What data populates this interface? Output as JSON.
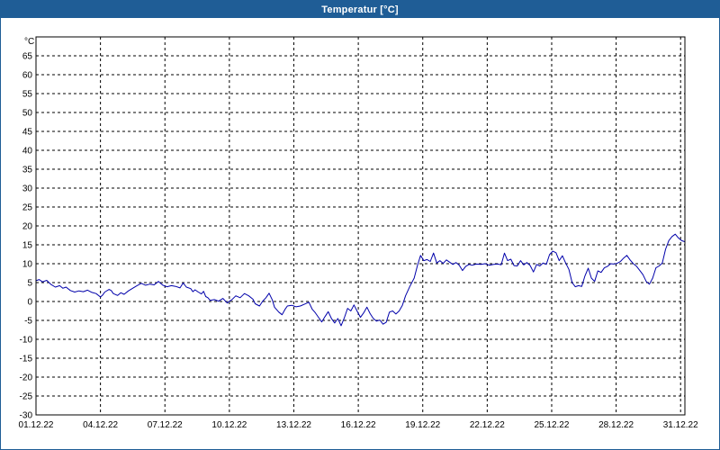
{
  "window": {
    "title": "Temperatur [°C]"
  },
  "chart_data": {
    "type": "line",
    "title": "Temperatur [°C]",
    "ylabel": "°C",
    "xlabel": "",
    "ylim": [
      -30,
      70
    ],
    "grid": true,
    "x_range": [
      "01.12.22",
      "02.01.23"
    ],
    "x_ticks": [
      "01.12.22",
      "04.12.22",
      "07.12.22",
      "10.12.22",
      "13.12.22",
      "16.12.22",
      "19.12.22",
      "22.12.22",
      "25.12.22",
      "28.12.22",
      "31.12.22"
    ],
    "y_ticks": [
      65,
      60,
      55,
      50,
      45,
      40,
      35,
      30,
      25,
      20,
      15,
      10,
      5,
      0,
      -5,
      -10,
      -15,
      -20,
      -25,
      -30
    ],
    "line_color": "#0000aa",
    "series": [
      {
        "values": [
          [
            0,
            5.5
          ],
          [
            0.15,
            5.8
          ],
          [
            0.3,
            5.2
          ],
          [
            0.5,
            5.6
          ],
          [
            0.7,
            4.5
          ],
          [
            0.9,
            3.8
          ],
          [
            1.1,
            4.2
          ],
          [
            1.25,
            3.5
          ],
          [
            1.4,
            3.8
          ],
          [
            1.6,
            2.9
          ],
          [
            1.8,
            2.5
          ],
          [
            2.0,
            2.8
          ],
          [
            2.2,
            2.6
          ],
          [
            2.4,
            3.0
          ],
          [
            2.6,
            2.4
          ],
          [
            2.8,
            2.1
          ],
          [
            3.0,
            1.2
          ],
          [
            3.1,
            1.7
          ],
          [
            3.2,
            2.5
          ],
          [
            3.4,
            3.2
          ],
          [
            3.5,
            2.9
          ],
          [
            3.6,
            2.1
          ],
          [
            3.8,
            1.6
          ],
          [
            3.95,
            2.3
          ],
          [
            4.1,
            1.9
          ],
          [
            4.3,
            2.8
          ],
          [
            4.5,
            3.5
          ],
          [
            4.7,
            4.2
          ],
          [
            4.9,
            4.8
          ],
          [
            5.1,
            4.3
          ],
          [
            5.3,
            4.6
          ],
          [
            5.5,
            4.4
          ],
          [
            5.7,
            5.3
          ],
          [
            5.9,
            4.3
          ],
          [
            6.1,
            3.9
          ],
          [
            6.3,
            4.2
          ],
          [
            6.5,
            4.0
          ],
          [
            6.7,
            3.6
          ],
          [
            6.85,
            4.9
          ],
          [
            7.0,
            3.8
          ],
          [
            7.2,
            3.4
          ],
          [
            7.3,
            2.6
          ],
          [
            7.4,
            3.1
          ],
          [
            7.55,
            2.5
          ],
          [
            7.7,
            2.0
          ],
          [
            7.8,
            2.7
          ],
          [
            7.9,
            1.3
          ],
          [
            8.0,
            1.0
          ],
          [
            8.1,
            0.3
          ],
          [
            8.3,
            0.5
          ],
          [
            8.5,
            0.1
          ],
          [
            8.7,
            0.8
          ],
          [
            8.9,
            -0.4
          ],
          [
            9.0,
            0.1
          ],
          [
            9.1,
            0.4
          ],
          [
            9.3,
            1.5
          ],
          [
            9.5,
            1.0
          ],
          [
            9.7,
            2.1
          ],
          [
            9.9,
            1.5
          ],
          [
            10.1,
            0.6
          ],
          [
            10.2,
            -0.6
          ],
          [
            10.4,
            -1.2
          ],
          [
            10.55,
            0.1
          ],
          [
            10.7,
            1.0
          ],
          [
            10.85,
            2.2
          ],
          [
            11.0,
            0.4
          ],
          [
            11.1,
            -1.5
          ],
          [
            11.3,
            -2.8
          ],
          [
            11.45,
            -3.5
          ],
          [
            11.6,
            -2.0
          ],
          [
            11.7,
            -1.2
          ],
          [
            11.9,
            -1.0
          ],
          [
            12.1,
            -1.4
          ],
          [
            12.3,
            -1.2
          ],
          [
            12.5,
            -0.7
          ],
          [
            12.7,
            -0.2
          ],
          [
            12.85,
            -2.0
          ],
          [
            13.0,
            -3.0
          ],
          [
            13.15,
            -4.2
          ],
          [
            13.3,
            -5.4
          ],
          [
            13.45,
            -4.0
          ],
          [
            13.6,
            -2.7
          ],
          [
            13.75,
            -4.5
          ],
          [
            13.9,
            -5.7
          ],
          [
            14.05,
            -4.5
          ],
          [
            14.2,
            -6.4
          ],
          [
            14.35,
            -4.3
          ],
          [
            14.5,
            -1.8
          ],
          [
            14.65,
            -2.5
          ],
          [
            14.8,
            -0.9
          ],
          [
            14.95,
            -2.6
          ],
          [
            15.1,
            -4.2
          ],
          [
            15.25,
            -3.0
          ],
          [
            15.4,
            -1.5
          ],
          [
            15.55,
            -3.2
          ],
          [
            15.7,
            -4.5
          ],
          [
            15.85,
            -5.2
          ],
          [
            16.0,
            -4.9
          ],
          [
            16.15,
            -6.0
          ],
          [
            16.3,
            -5.5
          ],
          [
            16.45,
            -2.8
          ],
          [
            16.6,
            -2.5
          ],
          [
            16.75,
            -3.3
          ],
          [
            16.9,
            -2.5
          ],
          [
            17.05,
            -1.0
          ],
          [
            17.2,
            1.5
          ],
          [
            17.4,
            4.0
          ],
          [
            17.6,
            6.2
          ],
          [
            17.75,
            9.5
          ],
          [
            17.9,
            12.2
          ],
          [
            18.05,
            10.8
          ],
          [
            18.2,
            11.1
          ],
          [
            18.35,
            10.6
          ],
          [
            18.5,
            12.8
          ],
          [
            18.65,
            10.2
          ],
          [
            18.8,
            10.8
          ],
          [
            18.95,
            10.1
          ],
          [
            19.1,
            11.0
          ],
          [
            19.25,
            10.4
          ],
          [
            19.4,
            9.8
          ],
          [
            19.55,
            10.3
          ],
          [
            19.7,
            9.6
          ],
          [
            19.85,
            8.2
          ],
          [
            20.0,
            9.3
          ],
          [
            20.15,
            9.8
          ],
          [
            20.3,
            9.6
          ],
          [
            20.5,
            9.9
          ],
          [
            20.7,
            9.8
          ],
          [
            20.9,
            10.0
          ],
          [
            21.1,
            9.6
          ],
          [
            21.3,
            9.8
          ],
          [
            21.5,
            9.9
          ],
          [
            21.65,
            9.7
          ],
          [
            21.8,
            12.8
          ],
          [
            21.95,
            10.8
          ],
          [
            22.1,
            11.2
          ],
          [
            22.25,
            9.5
          ],
          [
            22.4,
            9.4
          ],
          [
            22.55,
            10.8
          ],
          [
            22.7,
            9.7
          ],
          [
            22.85,
            10.3
          ],
          [
            23.0,
            9.5
          ],
          [
            23.15,
            7.8
          ],
          [
            23.3,
            9.8
          ],
          [
            23.45,
            9.4
          ],
          [
            23.6,
            10.2
          ],
          [
            23.75,
            9.8
          ],
          [
            23.9,
            12.4
          ],
          [
            24.05,
            13.3
          ],
          [
            24.2,
            12.9
          ],
          [
            24.35,
            10.8
          ],
          [
            24.5,
            12.1
          ],
          [
            24.65,
            10.2
          ],
          [
            24.8,
            8.5
          ],
          [
            24.95,
            5.0
          ],
          [
            25.1,
            3.9
          ],
          [
            25.25,
            4.2
          ],
          [
            25.4,
            4.0
          ],
          [
            25.55,
            6.8
          ],
          [
            25.7,
            8.8
          ],
          [
            25.85,
            6.2
          ],
          [
            26.0,
            5.3
          ],
          [
            26.15,
            8.1
          ],
          [
            26.3,
            7.7
          ],
          [
            26.45,
            8.9
          ],
          [
            26.6,
            9.3
          ],
          [
            26.75,
            10.0
          ],
          [
            26.9,
            9.9
          ],
          [
            27.05,
            10.1
          ],
          [
            27.2,
            10.6
          ],
          [
            27.35,
            11.5
          ],
          [
            27.5,
            12.2
          ],
          [
            27.65,
            11.0
          ],
          [
            27.8,
            10.0
          ],
          [
            27.95,
            9.3
          ],
          [
            28.1,
            8.2
          ],
          [
            28.25,
            7.1
          ],
          [
            28.4,
            5.3
          ],
          [
            28.55,
            4.6
          ],
          [
            28.7,
            6.2
          ],
          [
            28.85,
            8.9
          ],
          [
            29.0,
            9.4
          ],
          [
            29.15,
            10.2
          ],
          [
            29.3,
            13.8
          ],
          [
            29.45,
            16.1
          ],
          [
            29.6,
            17.2
          ],
          [
            29.75,
            17.8
          ],
          [
            29.9,
            16.8
          ],
          [
            30.05,
            16.1
          ],
          [
            30.2,
            15.8
          ]
        ]
      }
    ]
  }
}
